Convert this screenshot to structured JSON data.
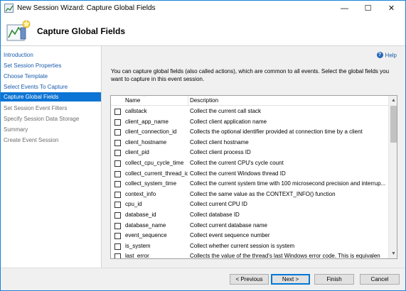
{
  "window": {
    "title": "New Session Wizard: Capture Global Fields",
    "minimize_glyph": "—",
    "maximize_glyph": "☐",
    "close_glyph": "✕"
  },
  "header": {
    "title": "Capture Global Fields",
    "icon": "wizard-chart-icon"
  },
  "nav": {
    "items": [
      {
        "label": "Introduction",
        "state": "link"
      },
      {
        "label": "Set Session Properties",
        "state": "link"
      },
      {
        "label": "Choose Template",
        "state": "link"
      },
      {
        "label": "Select Events To Capture",
        "state": "link"
      },
      {
        "label": "Capture Global Fields",
        "state": "selected"
      },
      {
        "label": "Set Session Event Filters",
        "state": "disabled"
      },
      {
        "label": "Specify Session Data Storage",
        "state": "disabled"
      },
      {
        "label": "Summary",
        "state": "disabled"
      },
      {
        "label": "Create Event Session",
        "state": "disabled"
      }
    ]
  },
  "content": {
    "help_label": "Help",
    "help_icon": "help-question-icon",
    "description": "You can capture global fields (also called actions), which are common to all events. Select the global fields you want to capture in this event session."
  },
  "grid": {
    "columns": [
      "Name",
      "Description"
    ],
    "rows": [
      {
        "name": "callstack",
        "desc": "Collect the current call stack",
        "checked": false
      },
      {
        "name": "client_app_name",
        "desc": "Collect client application name",
        "checked": false
      },
      {
        "name": "client_connection_id",
        "desc": "Collects the optional identifier provided at connection time by a client",
        "checked": false
      },
      {
        "name": "client_hostname",
        "desc": "Collect client hostname",
        "checked": false
      },
      {
        "name": "client_pid",
        "desc": "Collect client process ID",
        "checked": false
      },
      {
        "name": "collect_cpu_cycle_time",
        "desc": "Collect the current CPU's cycle count",
        "checked": false
      },
      {
        "name": "collect_current_thread_id",
        "desc": "Collect the current Windows thread ID",
        "checked": false
      },
      {
        "name": "collect_system_time",
        "desc": "Collect the current system time with 100 microsecond precision and interrup...",
        "checked": false
      },
      {
        "name": "context_info",
        "desc": "Collect the same value as the CONTEXT_INFO() function",
        "checked": false
      },
      {
        "name": "cpu_id",
        "desc": "Collect current CPU ID",
        "checked": false
      },
      {
        "name": "database_id",
        "desc": "Collect database ID",
        "checked": false
      },
      {
        "name": "database_name",
        "desc": "Collect current database name",
        "checked": false
      },
      {
        "name": "event_sequence",
        "desc": "Collect event sequence number",
        "checked": false
      },
      {
        "name": "is_system",
        "desc": "Collect whether current session is system",
        "checked": false
      },
      {
        "name": "last_error",
        "desc": "Collects the value of the thread's last Windows error code. This is equivalen",
        "checked": false
      }
    ]
  },
  "footer": {
    "prev_label": "< Previous",
    "next_label": "Next >",
    "finish_label": "Finish",
    "cancel_label": "Cancel"
  },
  "colors": {
    "selected_nav": "#0b74d4",
    "link": "#1a5cab",
    "window_border": "#1883d7"
  }
}
